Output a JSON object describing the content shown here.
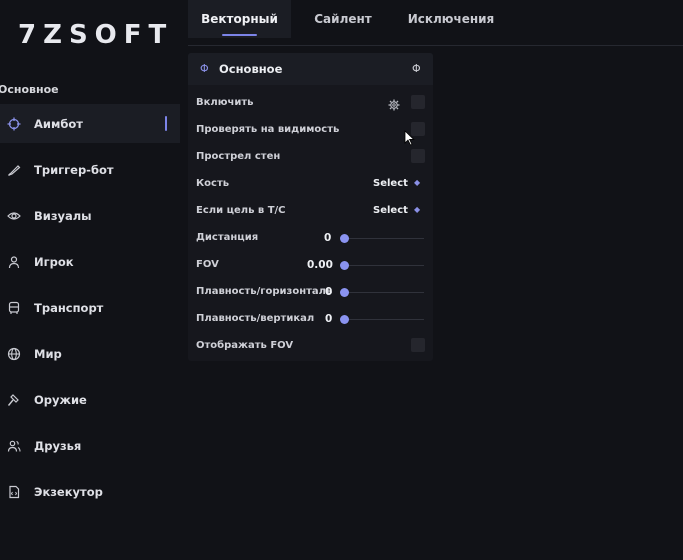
{
  "app": {
    "logo": "7ZSOFT"
  },
  "sidebar": {
    "section_label": "Основное",
    "items": [
      {
        "label": "Аимбот",
        "icon": "crosshair-icon",
        "active": true
      },
      {
        "label": "Триггер-бот",
        "icon": "knife-icon"
      },
      {
        "label": "Визуалы",
        "icon": "eye-icon"
      },
      {
        "label": "Игрок",
        "icon": "user-icon"
      },
      {
        "label": "Транспорт",
        "icon": "vehicle-icon"
      },
      {
        "label": "Мир",
        "icon": "globe-icon"
      },
      {
        "label": "Оружие",
        "icon": "hammer-icon"
      },
      {
        "label": "Друзья",
        "icon": "users-icon"
      },
      {
        "label": "Экзекутор",
        "icon": "script-file-icon"
      }
    ]
  },
  "tabs": [
    {
      "label": "Векторный",
      "active": true
    },
    {
      "label": "Сайлент"
    },
    {
      "label": "Исключения"
    }
  ],
  "panel": {
    "icon": "section-icon",
    "title": "Основное",
    "header_right_icon": "collapse-icon",
    "enable_label": "Включить",
    "visibility_label": "Проверять на видимость",
    "wallbang_label": "Прострел стен",
    "bone_label": "Кость",
    "bone_value": "Select",
    "target_tc_label": "Если цель в Т/С",
    "target_tc_value": "Select",
    "distance_label": "Дистанция",
    "distance_value": "0",
    "fov_label": "FOV",
    "fov_value": "0.00",
    "smooth_h_label": "Плавность/горизонталь",
    "smooth_h_value": "0",
    "smooth_v_label": "Плавность/вертикал",
    "smooth_v_value": "0",
    "show_fov_label": "Отображать FOV"
  },
  "colors": {
    "background": "#111217",
    "panel": "#16171d",
    "accent": "#7c84e8",
    "checkbox": "#25262d"
  }
}
